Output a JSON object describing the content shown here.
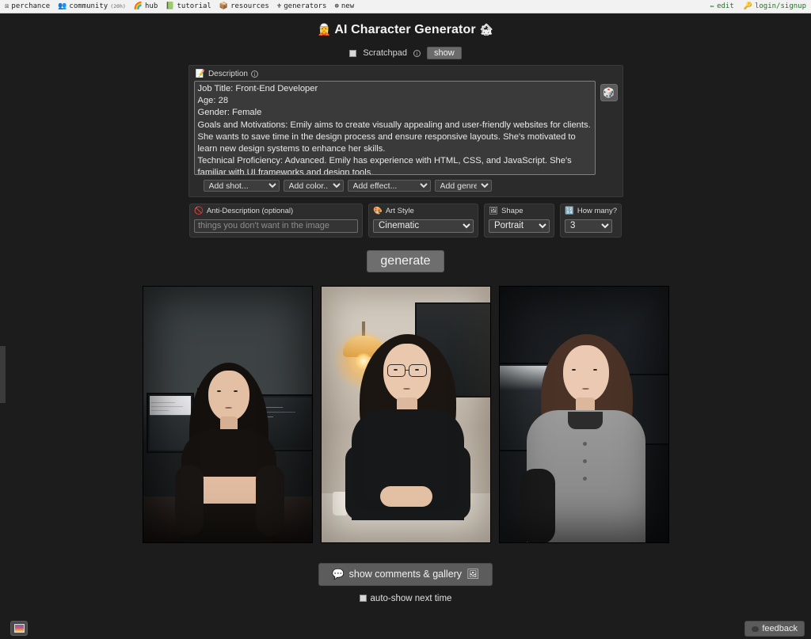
{
  "topbar": {
    "left_items": [
      {
        "icon": "perchance-logo-icon",
        "glyph": "☒",
        "label": "perchance",
        "sub": ""
      },
      {
        "icon": "people-icon",
        "glyph": "👥",
        "label": "community",
        "sub": "(20h)"
      },
      {
        "icon": "rainbow-icon",
        "glyph": "🌈",
        "label": "hub",
        "sub": ""
      },
      {
        "icon": "chalkboard-icon",
        "glyph": "📗",
        "label": "tutorial",
        "sub": ""
      },
      {
        "icon": "package-icon",
        "glyph": "📦",
        "label": "resources",
        "sub": ""
      },
      {
        "icon": "flask-icon",
        "glyph": "⚜",
        "label": "generators",
        "sub": ""
      },
      {
        "icon": "plus-circle-icon",
        "glyph": "⊕",
        "label": "new",
        "sub": ""
      }
    ],
    "right_items": [
      {
        "icon": "pencil-icon",
        "glyph": "✏",
        "label": "edit"
      },
      {
        "icon": "key-icon",
        "glyph": "🔑",
        "label": "login/signup"
      }
    ]
  },
  "page": {
    "title": "AI Character Generator",
    "title_emoji_left": "🧝",
    "title_emoji_right": "🏚"
  },
  "scratchpad": {
    "label": "Scratchpad",
    "info_glyph": "i",
    "show_label": "show",
    "checked": false
  },
  "description": {
    "panel_icon": "note-icon",
    "panel_icon_glyph": "📝",
    "header_label": "Description",
    "info_glyph": "i",
    "dice_icon": "dice-icon",
    "dice_glyph": "🎲",
    "value": "Job Title: Front-End Developer\nAge: 28\nGender: Female\nGoals and Motivations: Emily aims to create visually appealing and user-friendly websites for clients. She wants to save time in the design process and ensure responsive layouts. She's motivated to learn new design systems to enhance her skills.\nTechnical Proficiency: Advanced. Emily has experience with HTML, CSS, and JavaScript. She's familiar with UI frameworks and design tools.",
    "add_selects": [
      {
        "name": "add-shot-select",
        "selected": "Add shot...",
        "options": [
          "Add shot..."
        ]
      },
      {
        "name": "add-color-select",
        "selected": "Add color...",
        "options": [
          "Add color..."
        ]
      },
      {
        "name": "add-effect-select",
        "selected": "Add effect...",
        "options": [
          "Add effect..."
        ]
      },
      {
        "name": "add-genre-select",
        "selected": "Add genre...",
        "options": [
          "Add genre..."
        ]
      }
    ]
  },
  "options": {
    "anti_description": {
      "icon": "no-entry-icon",
      "icon_glyph": "🚫",
      "label": "Anti-Description (optional)",
      "placeholder": "things you don't want in the image",
      "value": ""
    },
    "art_style": {
      "icon": "palette-icon",
      "icon_glyph": "🎨",
      "label": "Art Style",
      "selected": "Cinematic",
      "options": [
        "Cinematic"
      ]
    },
    "shape": {
      "icon": "frame-icon",
      "icon_glyph": "🖼",
      "label": "Shape",
      "selected": "Portrait",
      "options": [
        "Portrait"
      ]
    },
    "how_many": {
      "icon": "number-icon",
      "icon_glyph": "🔢",
      "label": "How many?",
      "selected": "3",
      "options": [
        "3"
      ]
    }
  },
  "generate": {
    "label": "generate"
  },
  "gallery": {
    "images": [
      {
        "name": "generated-image-1",
        "alt": "woman in black dress in front of computer monitors"
      },
      {
        "name": "generated-image-2",
        "alt": "woman with glasses at desk with warm lamp"
      },
      {
        "name": "generated-image-3",
        "alt": "woman in grey knit top in dark office"
      }
    ]
  },
  "comments": {
    "bubble_icon": "speech-bubble-icon",
    "bubble_glyph": "💬",
    "label": "show comments & gallery",
    "trailing_icon": "picture-icon",
    "trailing_glyph": "🖼",
    "auto_show_label": "auto-show next time",
    "auto_show_checked": false
  },
  "corner": {
    "image_button_name": "image-preview-button",
    "feedback_label": "feedback"
  }
}
